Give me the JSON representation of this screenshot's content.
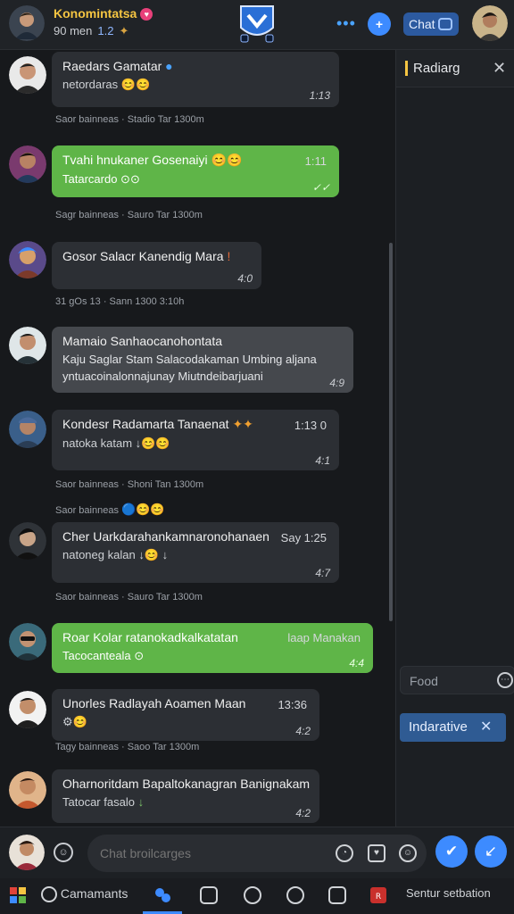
{
  "header": {
    "title": "Konomintatsa",
    "subtitle": "90 men",
    "count": "1.2",
    "chat_label": "Chat",
    "colors": {
      "title": "#f5c542",
      "accent": "#3d8bff"
    }
  },
  "right_panel": {
    "title": "Radiarg",
    "search_placeholder": "Food",
    "chip_label": "Indarative"
  },
  "messages": [
    {
      "name": "Raedars Gamatar",
      "text": "netordaras",
      "time": "1:13",
      "meta": "Saor bainneas · Stadio Tar 1300m",
      "style": "dark"
    },
    {
      "name": "Tvahi hnukaner Gosenaiyi",
      "text": "Tatarcardo",
      "time": "1:11",
      "meta": "Sagr bainneas · Sauro Tar 1300m",
      "style": "green"
    },
    {
      "name": "Gosor Salacr Kanendig Mara",
      "text": "",
      "time": "4:0",
      "meta": "31 gOs 13 · Sann 1300 3:10h",
      "style": "dark"
    },
    {
      "name": "Mamaio Sanhaocanohontata",
      "text": "Kaju Saglar Stam Salacodakaman Umbing aljana",
      "text2": "yntuacoinalonnajunay Miutndeibarjuani",
      "time": "4:9",
      "meta": "",
      "style": "gray"
    },
    {
      "name": "Kondesr Radamarta Tanaenat",
      "text": "natoka katam",
      "time": "4:1",
      "time_top": "1:13 0",
      "meta": "Saor bainneas · Shoni Tan 1300m",
      "style": "dark"
    },
    {
      "name": "Cher Uarkdarahankamnaronohanaen",
      "text": "natoneg kalan",
      "time": "4:7",
      "time_top": "Say 1:25",
      "meta": "Saor bainneas",
      "style": "dark"
    },
    {
      "name": "Roar Kolar ratanokadkalkatatan",
      "text": "Tacocanteala",
      "time": "4:4",
      "time_top": "laap Manakan",
      "meta": "Saor bainneas · Sauro Tar 1300m",
      "style": "green"
    },
    {
      "name": "Unorles Radlayah Aoamen Maan",
      "text": "",
      "time": "4:2",
      "time_top": "13:36",
      "meta": "Tagy bainneas · Saoo Tar 1300m",
      "style": "dark"
    },
    {
      "name": "Oharnoritdam Bapaltokanagran Banignakam",
      "text": "Tatocar fasalo",
      "time": "4:2",
      "meta": "",
      "style": "dark"
    }
  ],
  "composer": {
    "placeholder": "Chat broilcarges"
  },
  "bottom_nav": {
    "left_label": "Camamants",
    "right_label": "Sentur setbation"
  }
}
